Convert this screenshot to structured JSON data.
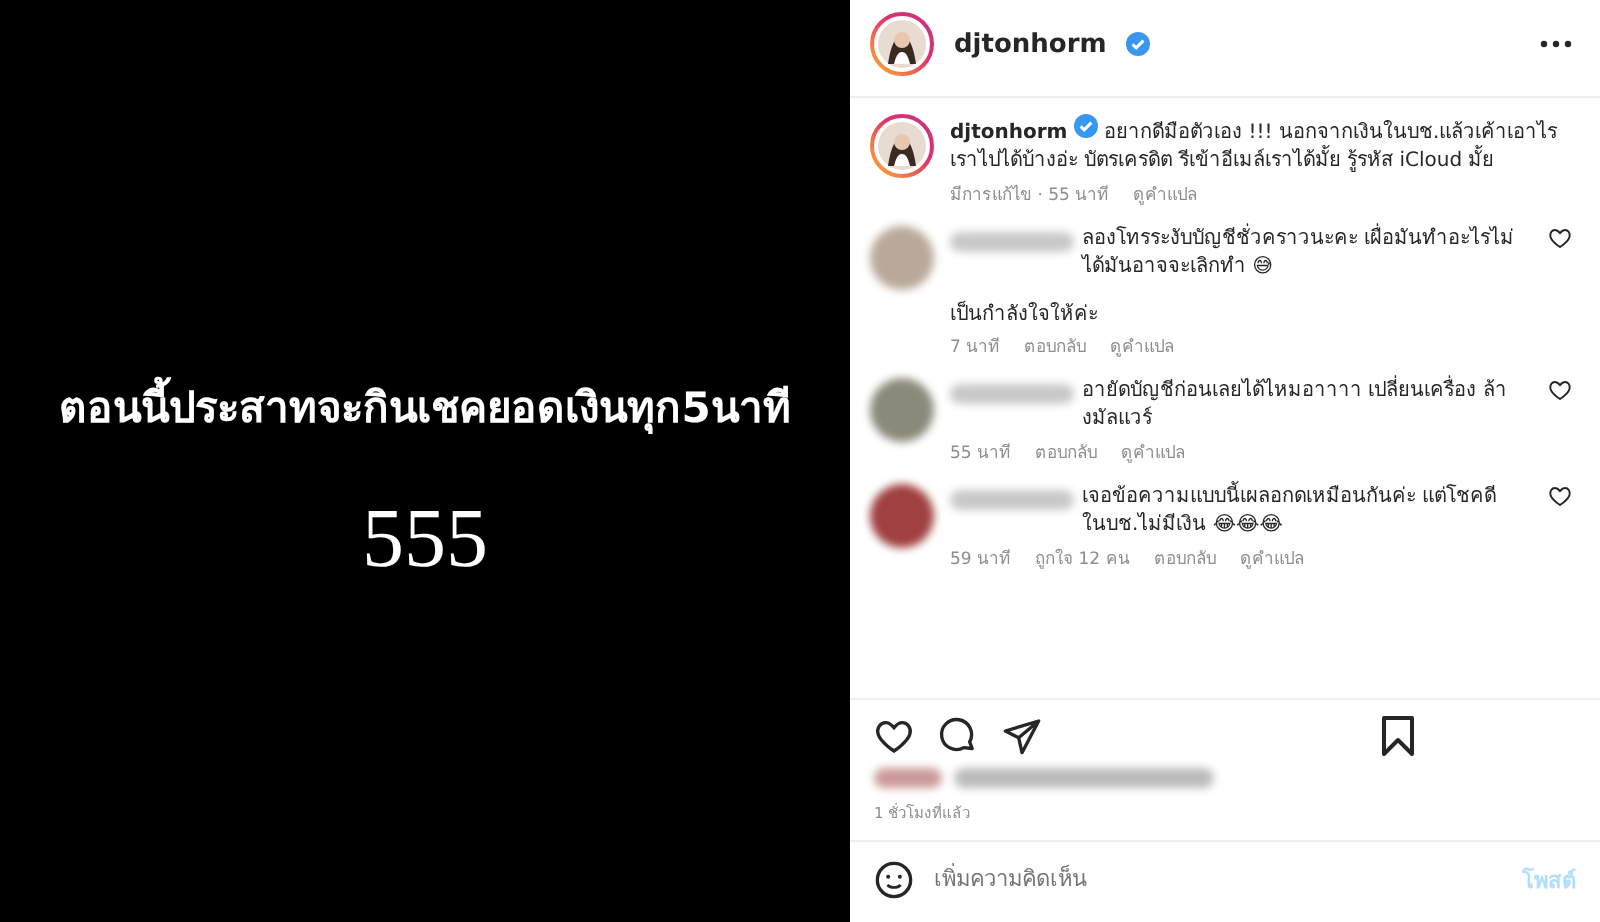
{
  "slide": {
    "headline": "ตอนนี้ประสาทจะกินเชคยอดเงินทุก5นาที",
    "subline": "555"
  },
  "header": {
    "username": "djtonhorm",
    "verified": true
  },
  "caption": {
    "username": "djtonhorm",
    "verified": true,
    "text": "อยากดีมือตัวเอง !!! นอกจากเงินในบช.แล้วเค้าเอาไรเราไปได้บ้างอ่ะ บัตรเครดิต รีเข้าอีเมล์เราได้มั้ย รู้รหัส iCloud มั้ย",
    "meta": [
      "มีการแก้ไข · 55 นาที",
      "ดูคำแปล"
    ]
  },
  "comments": [
    {
      "text": "ลองโทรระงับบัญชีชั่วคราวนะคะ เผื่อมันทำอะไรไม่ได้มันอาจจะเลิกทำ 😅",
      "extra": "เป็นกำลังใจให้ค่ะ",
      "meta": [
        "7 นาที",
        "ตอบกลับ",
        "ดูคำแปล"
      ],
      "color": "#b8a99a"
    },
    {
      "text": "อายัดบัญชีก่อนเลยได้ไหมอาาาา เปลี่ยนเครื่อง ล้างมัลแวร์",
      "meta": [
        "55 นาที",
        "ตอบกลับ",
        "ดูคำแปล"
      ],
      "color": "#8a8a7a"
    },
    {
      "text": "เจอข้อความแบบนี้เผลอกดเหมือนกันค่ะ แต่โชคดีในบช.ไม่มีเงิน 😂😂😂",
      "meta": [
        "59 นาที",
        "ถูกใจ 12 คน",
        "ตอบกลับ",
        "ดูคำแปล"
      ],
      "color": "#a04040"
    }
  ],
  "time_ago": "1 ชั่วโมงที่แล้ว",
  "comment_box": {
    "placeholder": "เพิ่มความคิดเห็น",
    "post": "โพสต์"
  }
}
